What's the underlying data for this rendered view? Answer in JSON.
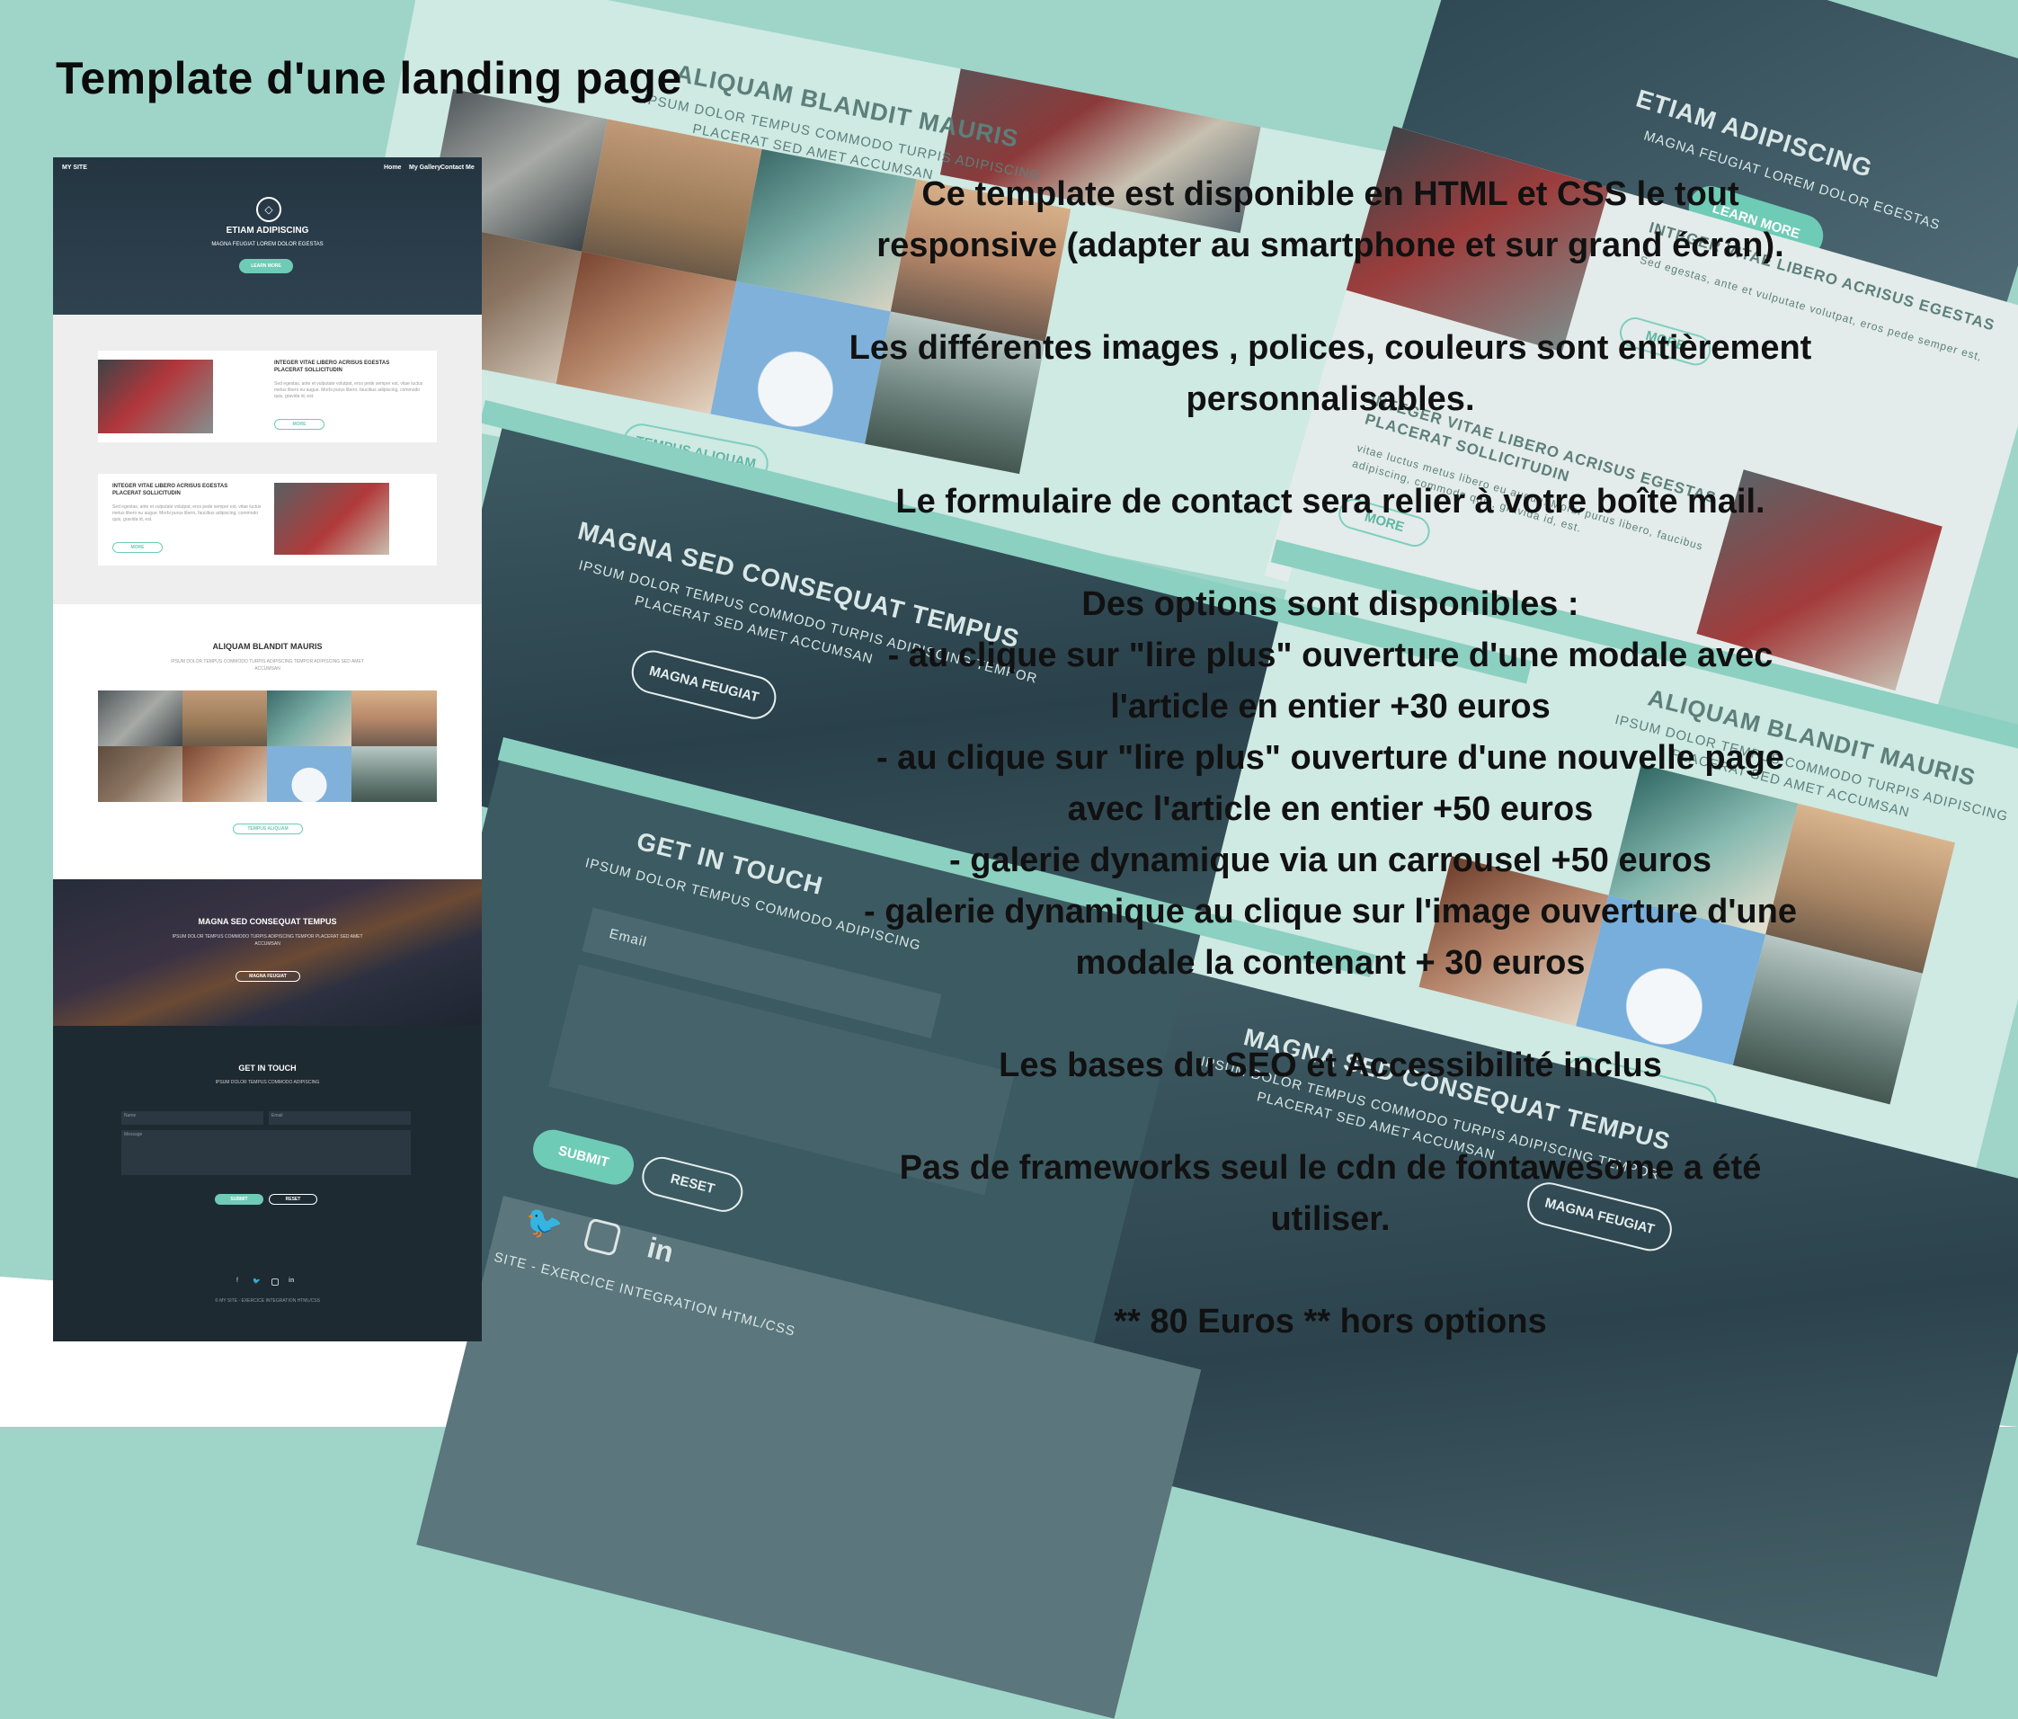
{
  "title": "Template d'une landing page",
  "description": {
    "p1": [
      "Ce template est disponible en HTML et CSS le tout",
      "responsive (adapter au smartphone et sur grand écran)."
    ],
    "p2": [
      "Les différentes images , polices, couleurs sont entièrement",
      "personnalisables."
    ],
    "p3": [
      "Le formulaire de contact sera relier à votre boîte mail."
    ],
    "p4": [
      "Des options sont disponibles :",
      "- au clique sur \"lire plus\" ouverture d'une modale avec",
      "l'article en entier +30 euros",
      "- au clique sur \"lire plus\" ouverture d'une nouvelle page",
      "avec l'article en entier +50 euros",
      "- galerie dynamique via un carrousel +50 euros",
      "- galerie dynamique au clique sur l'image ouverture d'une",
      "modale la contenant + 30 euros"
    ],
    "p5": [
      "Les bases du SEO et Accessibilité inclus"
    ],
    "p6": [
      "Pas de frameworks seul le cdn de fontawesome a été",
      "utiliser."
    ],
    "p7": [
      "** 80 Euros ** hors options"
    ]
  },
  "collage": {
    "gallery_title": "ALIQUAM BLANDIT MAURIS",
    "gallery_sub_1": "IPSUM DOLOR TEMPUS COMMODO TURPIS ADIPISCING",
    "gallery_sub_2": "PLACERAT SED AMET ACCUMSAN",
    "gallery_btn": "TEMPUS ALIQUAM",
    "banner_title": "MAGNA SED CONSEQUAT TEMPUS",
    "banner_sub_1": "IPSUM DOLOR TEMPUS COMMODO TURPIS ADIPISCING TEMPOR",
    "banner_sub_2": "PLACERAT SED AMET ACCUMSAN",
    "banner_btn": "MAGNA FEUGIAT",
    "contact_title": "GET IN TOUCH",
    "contact_sub": "IPSUM DOLOR TEMPUS COMMODO ADIPISCING",
    "email_placeholder": "Email",
    "submit": "SUBMIT",
    "reset": "RESET",
    "copyright": "© MY SITE - EXERCICE INTEGRATION HTML/CSS",
    "hero_title": "ETIAM ADIPISCING",
    "hero_sub": "MAGNA FEUGIAT LOREM DOLOR EGESTAS",
    "hero_btn": "LEARN MORE",
    "card_title_1": "INTEGER VITAE LIBERO ACRISUS EGESTAS",
    "card_title_2": "PLACERAT SOLLICITUDIN",
    "card_text_1": "Sed egestas, ante et vulputate volutpat, eros pede semper est,",
    "card_text_2": "vitae luctus metus libero eu augue. Morbi purus libero, faucibus",
    "card_text_3": "adipiscing, commodo quis, gravida id, est.",
    "card_btn": "MORE"
  },
  "preview": {
    "logo": "MY SITE",
    "nav": [
      "Home",
      "My Gallery",
      "Contact Me"
    ],
    "hero_title": "ETIAM ADIPISCING",
    "hero_sub": "MAGNA FEUGIAT LOREM DOLOR EGESTAS",
    "hero_btn": "LEARN MORE",
    "card1_title": "INTEGER VITAE LIBERO ACRISUS EGESTAS PLACERAT SOLLICITUDIN",
    "card2_title": "INTEGER VITAE LIBERO ACRISUS EGESTAS PLACERAT SOLLICITUDIN",
    "card_text": "Sed egestas, ante et vulputate volutpat, eros pede semper est, vitae luctus metus libero eu augue. Morbi purus libero, faucibus adipiscing, commodo quis, gravida id, est.",
    "card_btn": "MORE",
    "gallery_title": "ALIQUAM BLANDIT MAURIS",
    "gallery_sub": "IPSUM DOLOR TEMPUS COMMODO TURPIS ADIPISCING TEMPOR ADIPISCING SED AMET ACCUMSAN",
    "gallery_btn": "TEMPUS ALIQUAM",
    "banner_title": "MAGNA SED CONSEQUAT TEMPUS",
    "banner_sub": "IPSUM DOLOR TEMPUS COMMODO TURPIS ADIPISCING TEMPOR PLACERAT SED AMET ACCUMSAN",
    "banner_btn": "MAGNA FEUGIAT",
    "contact_title": "GET IN TOUCH",
    "contact_sub": "IPSUM DOLOR TEMPUS COMMODO ADIPISCING",
    "name_placeholder": "Name",
    "email_placeholder": "Email",
    "message_placeholder": "Message",
    "submit": "SUBMIT",
    "reset": "RESET",
    "social_icons": [
      "facebook-icon",
      "twitter-icon",
      "instagram-icon",
      "linkedin-icon"
    ],
    "copyright": "© MY SITE - EXERCICE INTEGRATION HTML/CSS"
  },
  "colors": {
    "background": "#9ed5c8",
    "accent": "#6ecbb6",
    "dark": "#1f2b33",
    "text": "#111111"
  }
}
